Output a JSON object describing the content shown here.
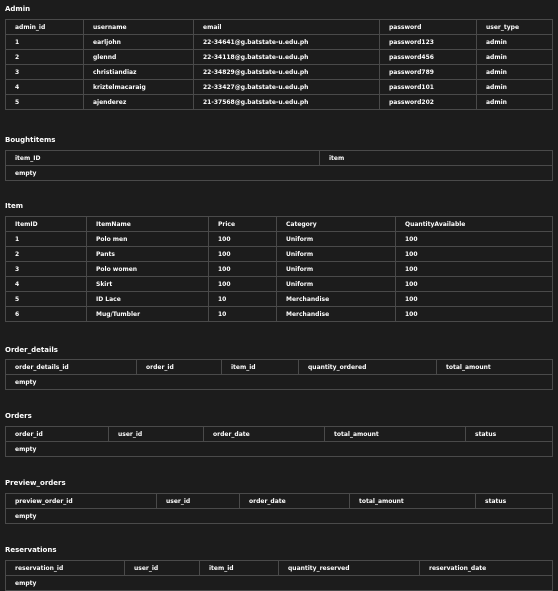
{
  "admin": {
    "title": "Admin",
    "columns": [
      "admin_id",
      "username",
      "email",
      "password",
      "user_type"
    ],
    "rows": [
      [
        "1",
        "earljohn",
        "22-34641@g.batstate-u.edu.ph",
        "password123",
        "admin"
      ],
      [
        "2",
        "glennd",
        "22-34118@g.batstate-u.edu.ph",
        "password456",
        "admin"
      ],
      [
        "3",
        "christiandiaz",
        "22-34829@g.batstate-u.edu.ph",
        "password789",
        "admin"
      ],
      [
        "4",
        "kriztelmacaraig",
        "22-33427@g.batstate-u.edu.ph",
        "password101",
        "admin"
      ],
      [
        "5",
        "ajenderez",
        "21-37568@g.batstate-u.edu.ph",
        "password202",
        "admin"
      ]
    ]
  },
  "boughtitems": {
    "title": "Boughtitems",
    "columns": [
      "item_ID",
      "item"
    ],
    "empty_text": "empty"
  },
  "item": {
    "title": "Item",
    "columns": [
      "ItemID",
      "ItemName",
      "Price",
      "Category",
      "QuantityAvailable"
    ],
    "rows": [
      [
        "1",
        "Polo men",
        "100",
        "Uniform",
        "100"
      ],
      [
        "2",
        "Pants",
        "100",
        "Uniform",
        "100"
      ],
      [
        "3",
        "Polo women",
        "100",
        "Uniform",
        "100"
      ],
      [
        "4",
        "Skirt",
        "100",
        "Uniform",
        "100"
      ],
      [
        "5",
        "ID Lace",
        "10",
        "Merchandise",
        "100"
      ],
      [
        "6",
        "Mug/Tumbler",
        "10",
        "Merchandise",
        "100"
      ]
    ]
  },
  "order_details": {
    "title": "Order_details",
    "columns": [
      "order_details_id",
      "order_id",
      "item_id",
      "quantity_ordered",
      "total_amount"
    ],
    "empty_text": "empty"
  },
  "orders": {
    "title": "Orders",
    "columns": [
      "order_id",
      "user_id",
      "order_date",
      "total_amount",
      "status"
    ],
    "empty_text": "empty"
  },
  "preview_orders": {
    "title": "Preview_orders",
    "columns": [
      "preview_order_id",
      "user_id",
      "order_date",
      "total_amount",
      "status"
    ],
    "empty_text": "empty"
  },
  "reservations": {
    "title": "Reservations",
    "columns": [
      "reservation_id",
      "user_id",
      "item_id",
      "quantity_reserved",
      "reservation_date"
    ],
    "empty_text": "empty"
  }
}
